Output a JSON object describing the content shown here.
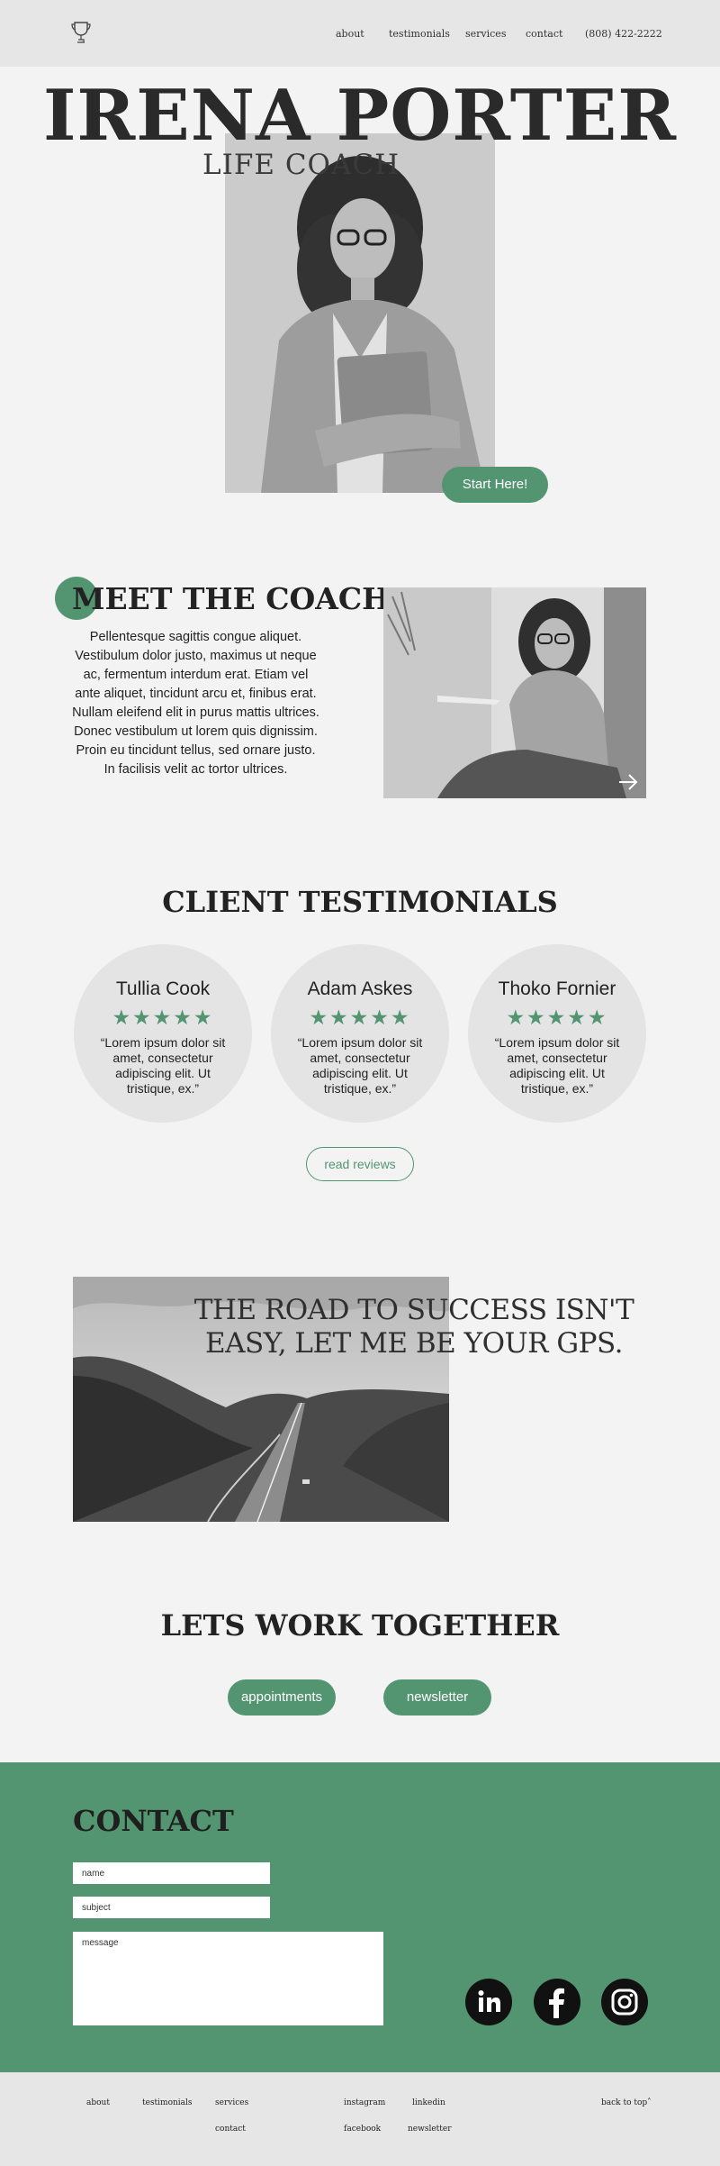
{
  "nav": {
    "about": "about",
    "testimonials": "testimonials",
    "services": "services",
    "contact": "contact",
    "phone": "(808) 422-2222"
  },
  "hero": {
    "name": "IRENA PORTER",
    "subtitle": "LIFE COACH",
    "cta": "Start Here!"
  },
  "meet": {
    "title": "MEET THE COACH",
    "text": "Pellentesque sagittis congue aliquet. Vestibulum dolor justo, maximus ut neque ac, fermentum interdum erat. Etiam vel ante aliquet, tincidunt arcu et, finibus erat. Nullam eleifend elit in purus mattis ultrices. Donec vestibulum ut lorem quis dignissim. Proin eu tincidunt tellus, sed ornare justo. In facilisis velit ac tortor ultrices."
  },
  "testimonials": {
    "title": "CLIENT TESTIMONIALS",
    "items": [
      {
        "name": "Tullia Cook",
        "stars": "★★★★★",
        "quote": "“Lorem ipsum dolor sit amet, consectetur adipiscing elit. Ut tristique, ex.”"
      },
      {
        "name": "Adam Askes",
        "stars": "★★★★★",
        "quote": "“Lorem ipsum dolor sit amet, consectetur adipiscing elit. Ut tristique, ex.”"
      },
      {
        "name": "Thoko Fornier",
        "stars": "★★★★★",
        "quote": "“Lorem ipsum dolor sit amet, consectetur adipiscing elit. Ut tristique, ex.”"
      }
    ],
    "reviews_button": "read reviews"
  },
  "road": {
    "quote": "THE  ROAD TO SUCCESS ISN'T EASY, LET ME BE YOUR GPS."
  },
  "work": {
    "title": "LETS WORK TOGETHER",
    "appointments": "appointments",
    "newsletter": "newsletter"
  },
  "contact": {
    "title": "CONTACT",
    "name_placeholder": "name",
    "subject_placeholder": "subject",
    "message_placeholder": "message"
  },
  "footer": {
    "about": "about",
    "testimonials": "testimonials",
    "services": "services",
    "contact": "contact",
    "instagram": "instagram",
    "linkedin": "linkedin",
    "facebook": "facebook",
    "newsletter": "newsletter",
    "back_to_top": "back to top˄"
  },
  "colors": {
    "accent": "#539571",
    "background": "#f3f3f4",
    "header": "#e6e6e7"
  }
}
